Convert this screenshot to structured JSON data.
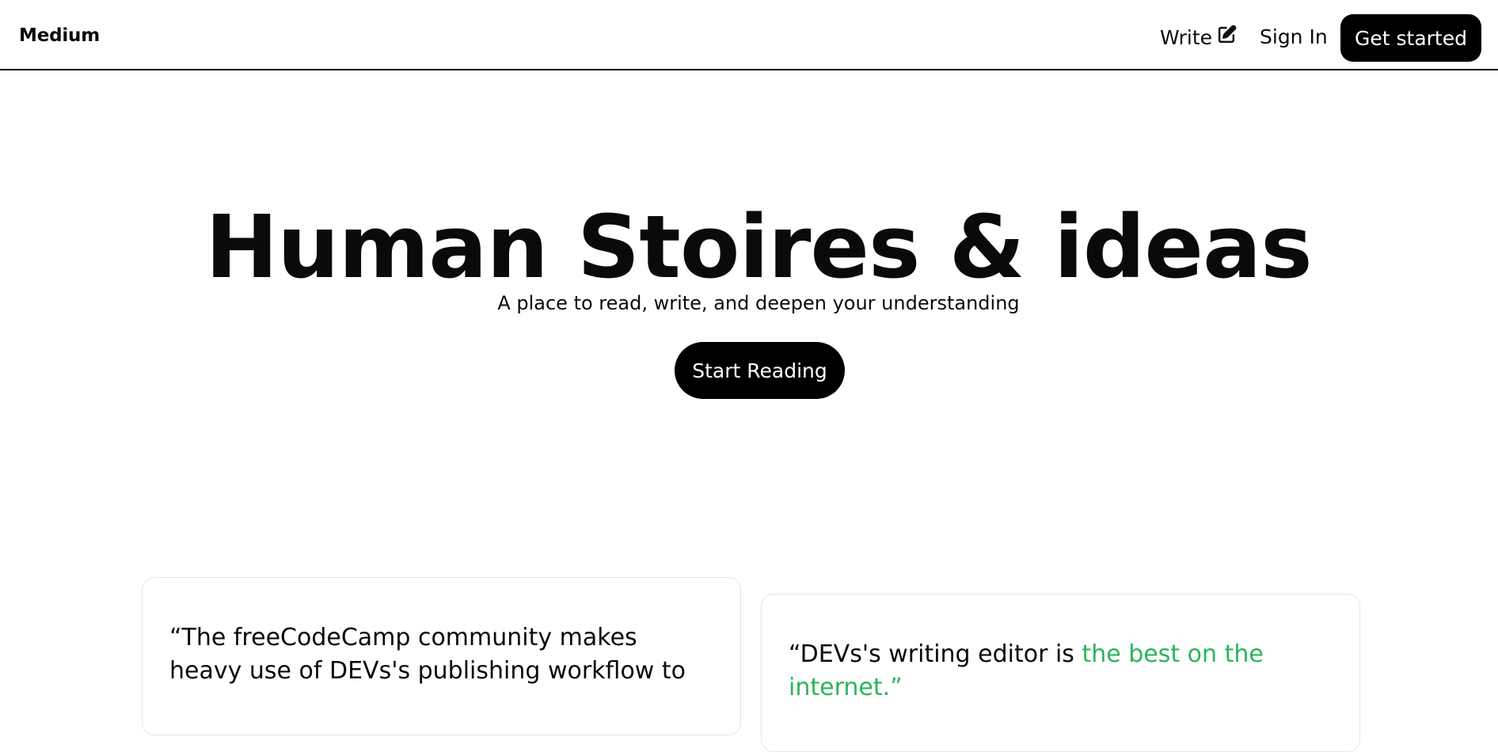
{
  "header": {
    "brand": "Medium",
    "write_label": "Write",
    "write_icon": "edit-icon",
    "signin_label": "Sign In",
    "get_started_label": "Get started"
  },
  "hero": {
    "title": "Human Stoires & ideas",
    "subtitle": "A place to read, write, and deepen your understanding",
    "cta_label": "Start Reading"
  },
  "testimonials": [
    {
      "quote_text": "“The freeCodeCamp community makes heavy use of DEVs's publishing workflow to"
    },
    {
      "quote_prefix": "“DEVs's writing editor is ",
      "quote_highlight": "the best on the internet.”",
      "highlight_color": "#2bb55a"
    }
  ]
}
